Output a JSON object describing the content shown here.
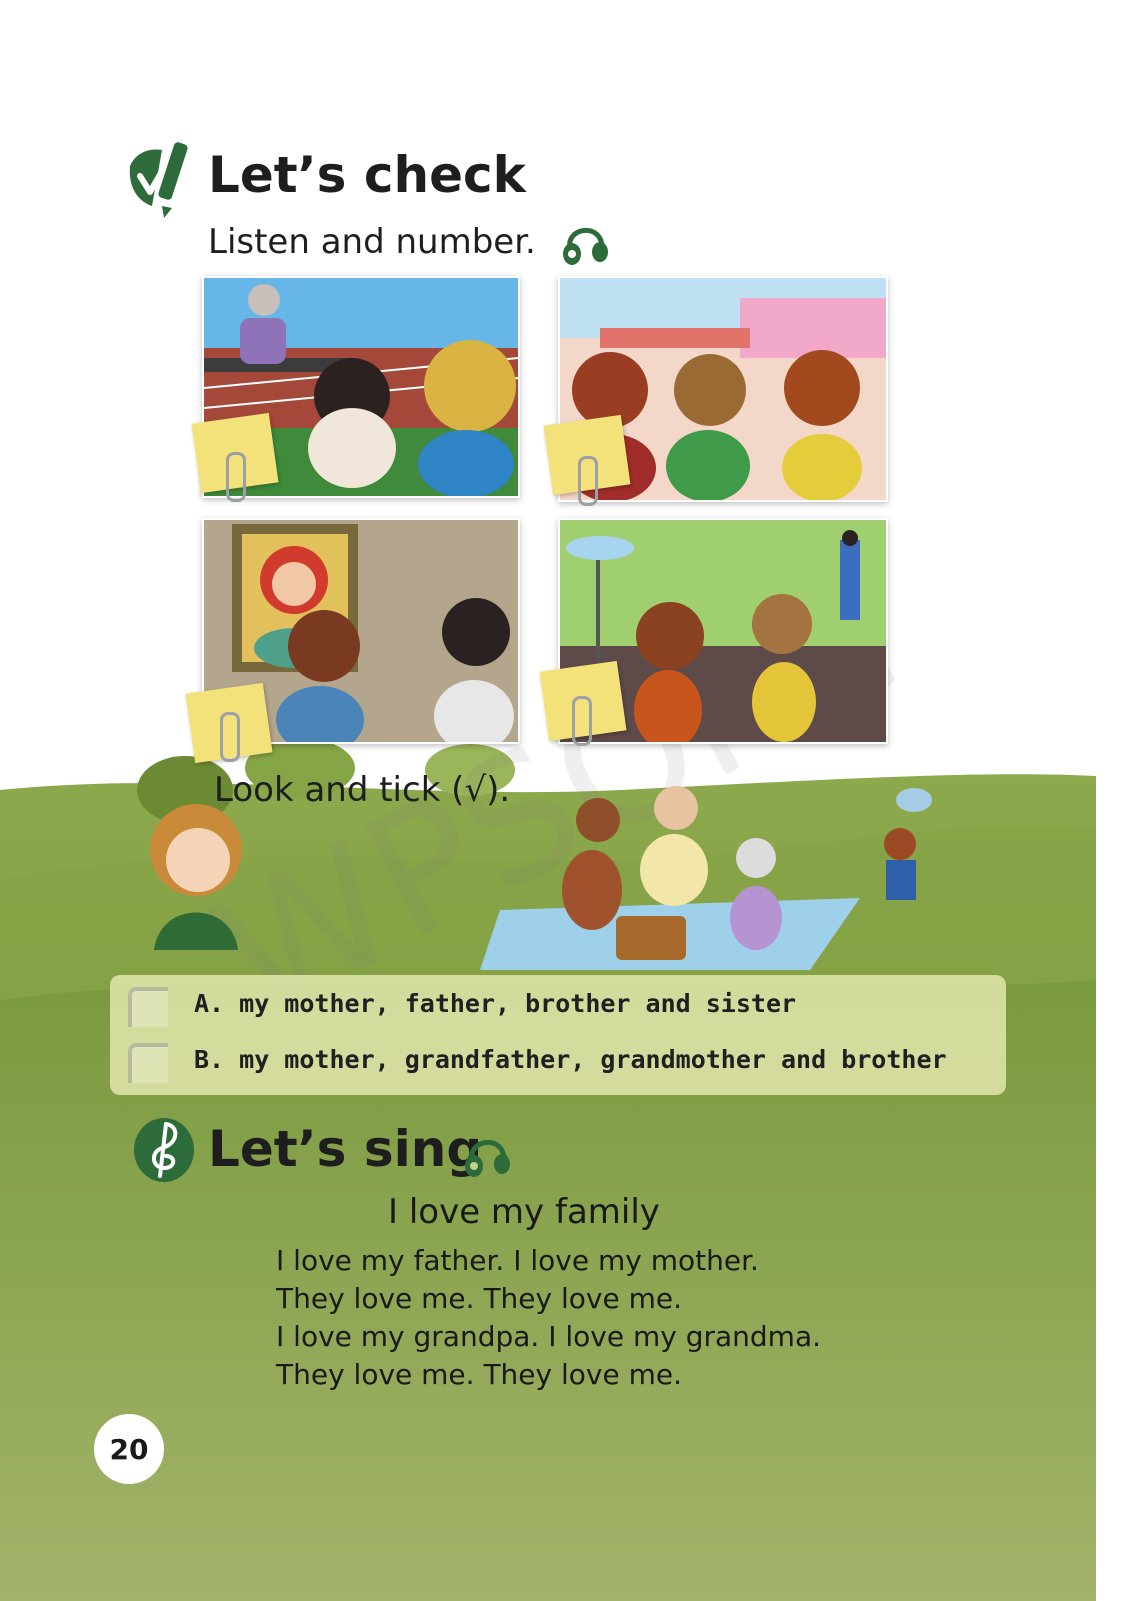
{
  "check": {
    "heading": "Let’s check",
    "listen_instruction": "Listen and number.",
    "look_instruction": "Look and tick (√).",
    "options": [
      {
        "label": "A. my mother, father, brother and sister"
      },
      {
        "label": "B. my mother, grandfather, grandmother and brother"
      }
    ]
  },
  "sing": {
    "heading": "Let’s sing",
    "song_title": "I love my family",
    "lyrics": [
      "I love my father. I love my mother.",
      "They love me. They love me.",
      "I love my grandpa. I love my grandma.",
      "They love me. They love me."
    ]
  },
  "page_number": "20",
  "watermark": "WPSOrie",
  "colors": {
    "section_icon_green": "#2e6b3a",
    "hill_green": "#7e9a3f",
    "options_panel": "#dfe4aa"
  },
  "icons": {
    "check_section": "pencil-check-icon",
    "sing_section": "music-note-icon",
    "audio": "headphones-icon"
  }
}
